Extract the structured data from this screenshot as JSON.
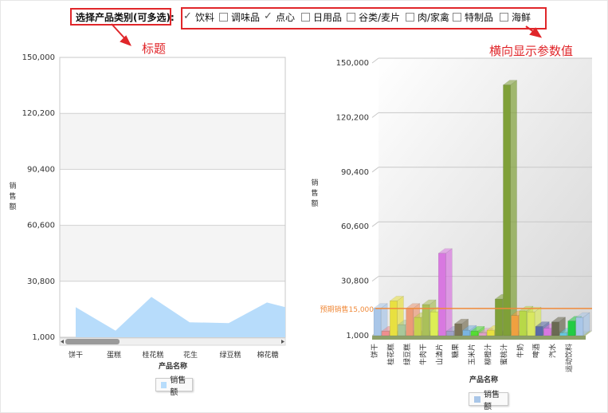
{
  "filter": {
    "label": "选择产品类别(可多选):",
    "options": [
      {
        "label": "饮料",
        "checked": true
      },
      {
        "label": "调味品",
        "checked": false
      },
      {
        "label": "点心",
        "checked": true
      },
      {
        "label": "日用品",
        "checked": false
      },
      {
        "label": "谷类/麦片",
        "checked": false
      },
      {
        "label": "肉/家禽",
        "checked": false
      },
      {
        "label": "特制品",
        "checked": false
      },
      {
        "label": "海鲜",
        "checked": false
      }
    ]
  },
  "annotations": {
    "title_note": "标题",
    "horizontal_note": "横向显示参数值"
  },
  "chart_data": [
    {
      "type": "area",
      "ylabel": "销售额",
      "xlabel": "产品名称",
      "yticks": [
        "150,000",
        "120,200",
        "90,400",
        "60,600",
        "30,800",
        "1,000"
      ],
      "ylim": [
        1000,
        150000
      ],
      "categories": [
        "饼干",
        "蛋糕",
        "桂花糕",
        "花生",
        "绿豆糕",
        "棉花糖"
      ],
      "series": [
        {
          "name": "销售额",
          "values": [
            17000,
            4500,
            22500,
            9000,
            8500,
            19500,
            17000
          ]
        }
      ],
      "legend": "销售额",
      "color": "#b7dcfb",
      "grid": true
    },
    {
      "type": "bar",
      "style": "3d",
      "ylabel": "销售额",
      "xlabel": "产品名称",
      "yticks": [
        "150,000",
        "120,200",
        "90,400",
        "60,600",
        "30,800",
        "1,000"
      ],
      "ylim": [
        1000,
        150000
      ],
      "categories": [
        "饼干",
        "桂花糕",
        "绿豆糕",
        "牛肉干",
        "山渣片",
        "糖果",
        "玉米片",
        "柳橙汁",
        "蜜桃汁",
        "牛奶",
        "啤酒",
        "汽水",
        "运动饮料"
      ],
      "values": [
        [
          16000,
          3500
        ],
        [
          20000,
          7000
        ],
        [
          16000,
          11000
        ],
        [
          18000,
          14000
        ],
        [
          46000,
          3500
        ],
        [
          7500,
          4000
        ],
        [
          3500,
          2500
        ],
        [
          4000,
          21000
        ],
        [
          138000,
          12000
        ],
        [
          14500,
          14000
        ],
        [
          6000,
          5000
        ],
        [
          8500,
          2500
        ],
        [
          9000,
          11000
        ]
      ],
      "colors": [
        [
          "#a9c6e8",
          "#ef8f8f"
        ],
        [
          "#e8e040",
          "#a8c89a"
        ],
        [
          "#eb9a78",
          "#c6d24e"
        ],
        [
          "#aac05a",
          "#ddee55"
        ],
        [
          "#d878e0",
          "#9ea0c8"
        ],
        [
          "#7c7458",
          "#7ab4e0"
        ],
        [
          "#55dd33",
          "#e0a0c8"
        ],
        [
          "#e8e040",
          "#7fa038"
        ],
        [
          "#7fa038",
          "#f0a040"
        ],
        [
          "#b8d848",
          "#d8e860"
        ],
        [
          "#5a6aa8",
          "#d878e0"
        ],
        [
          "#6a6a52",
          "#66c8e0"
        ],
        [
          "#22cc44",
          "#a9c6e8"
        ]
      ],
      "reference_line": {
        "label": "预期销售15,000",
        "value": 15000,
        "color": "#f08a3a"
      },
      "legend": "销售额",
      "grid": true
    }
  ]
}
